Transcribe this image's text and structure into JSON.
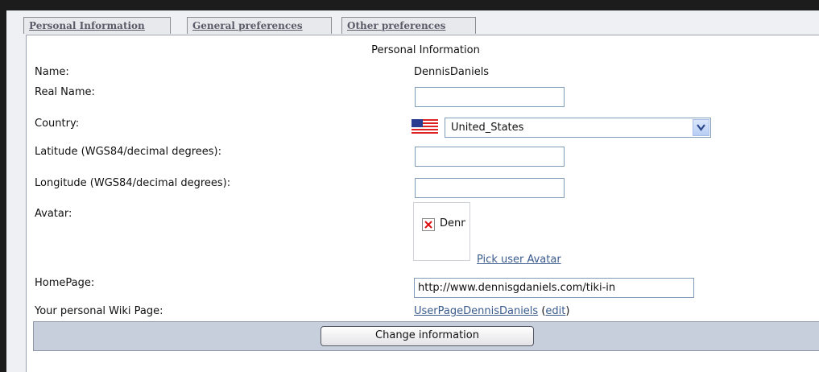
{
  "tabs": [
    {
      "label": "Personal Information"
    },
    {
      "label": "General preferences"
    },
    {
      "label": "Other preferences"
    }
  ],
  "section_title": "Personal Information",
  "fields": {
    "name": {
      "label": "Name:",
      "value": "DennisDaniels"
    },
    "real_name": {
      "label": "Real Name:",
      "value": ""
    },
    "country": {
      "label": "Country:",
      "value": "United_States",
      "flag_icon": "us-flag-icon"
    },
    "latitude": {
      "label": "Latitude (WGS84/decimal degrees):",
      "value": ""
    },
    "longitude": {
      "label": "Longitude (WGS84/decimal degrees):",
      "value": ""
    },
    "avatar": {
      "label": "Avatar:",
      "alt_text": "Dennis",
      "pick_link": "Pick user Avatar"
    },
    "homepage": {
      "label": "HomePage:",
      "value": "http://www.dennisgdaniels.com/tiki-in"
    },
    "wiki_page": {
      "label": "Your personal Wiki Page:",
      "link": "UserPageDennisDaniels",
      "open_paren": "(",
      "edit": "edit",
      "close_paren": ")"
    }
  },
  "submit_button": "Change information",
  "colors": {
    "link": "#3a5b8c",
    "button_bar": "#c7cfdc",
    "panel": "#eef0f3"
  }
}
